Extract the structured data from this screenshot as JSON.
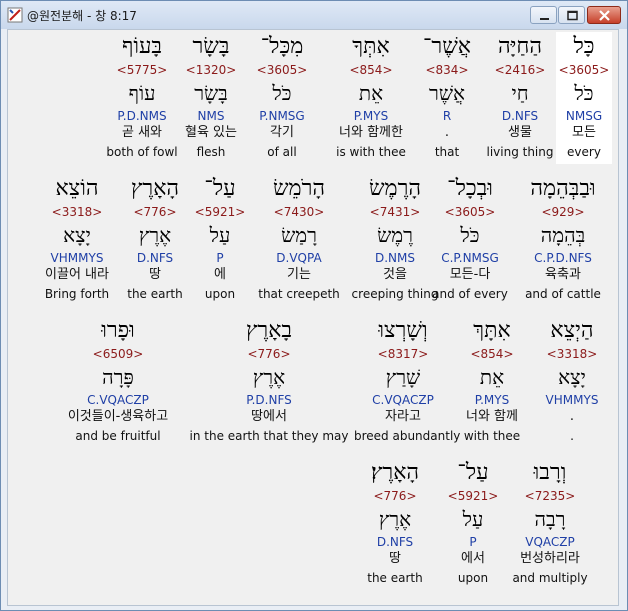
{
  "window": {
    "title": "@원전분해 - 창 8:17"
  },
  "rows": [
    [
      {
        "heb": "כָּל",
        "num": "<3605>",
        "lex": "כֹּל",
        "morph": "NMSG",
        "kor": "모든",
        "eng": "every",
        "highlight": true
      },
      {
        "heb": "הַחַיָּה",
        "num": "<2416>",
        "lex": "חַי",
        "morph": "D.NFS",
        "kor": "생물",
        "eng": "living thing"
      },
      {
        "heb": "אֲשֶׁר־",
        "num": "<834>",
        "lex": "אֲשֶׁר",
        "morph": "R",
        "kor": ".",
        "eng": "that"
      },
      {
        "heb": "אִתְּךָ",
        "num": "<854>",
        "lex": "אֵת",
        "morph": "P.MYS",
        "kor": "너와 함께한",
        "eng": "is with thee"
      },
      {
        "heb": "מִכָּל־",
        "num": "<3605>",
        "lex": "כֹּל",
        "morph": "P.NMSG",
        "kor": "각기",
        "eng": "of all"
      },
      {
        "heb": "בָּשָׂר",
        "num": "<1320>",
        "lex": "בָּשָׂר",
        "morph": "NMS",
        "kor": "혈육 있는",
        "eng": "flesh"
      },
      {
        "heb": "בָּעוֹף",
        "num": "<5775>",
        "lex": "עוֹף",
        "morph": "P.D.NMS",
        "kor": "곧 새와",
        "eng": "both of fowl"
      }
    ],
    [
      {
        "heb": "וּבַבְּהֵמָה",
        "num": "<929>",
        "lex": "בְּהֵמָה",
        "morph": "C.P.D.NFS",
        "kor": "육축과",
        "eng": "and of cattle"
      },
      {
        "heb": "וּבְכָל־",
        "num": "<3605>",
        "lex": "כֹּל",
        "morph": "C.P.NMSG",
        "kor": "모든-다",
        "eng": "and of every"
      },
      {
        "heb": "הָרֶמֶשׂ",
        "num": "<7431>",
        "lex": "רֶמֶשׂ",
        "morph": "D.NMS",
        "kor": "것을",
        "eng": "creeping thing"
      },
      {
        "heb": "הָרֹמֵשׂ",
        "num": "<7430>",
        "lex": "רָמַשׂ",
        "morph": "D.VQPA",
        "kor": "기는",
        "eng": "that creepeth"
      },
      {
        "heb": "עַל־",
        "num": "<5921>",
        "lex": "עַל",
        "morph": "P",
        "kor": "에",
        "eng": "upon"
      },
      {
        "heb": "הָאָרֶץ",
        "num": "<776>",
        "lex": "אֶרֶץ",
        "morph": "D.NFS",
        "kor": "땅",
        "eng": "the earth"
      },
      {
        "heb": "הוֹצֵא",
        "num": "<3318>",
        "lex": "יָצָא",
        "morph": "VHMMYS",
        "kor": "이끌어 내라",
        "eng": "Bring forth"
      }
    ],
    [
      {
        "heb": "הַיְצֵא",
        "num": "<3318>",
        "lex": "יָצָא",
        "morph": "VHMMYS",
        "kor": ".",
        "eng": "."
      },
      {
        "heb": "אִתָּךְ",
        "num": "<854>",
        "lex": "אֵת",
        "morph": "P.MYS",
        "kor": "너와 함께",
        "eng": "with thee"
      },
      {
        "heb": "וְשָׁרְצוּ",
        "num": "<8317>",
        "lex": "שָׁרַץ",
        "morph": "C.VQACZP",
        "kor": "자라고",
        "eng": "breed abundantly"
      },
      {
        "heb": "בָאָרֶץ",
        "num": "<776>",
        "lex": "אֶרֶץ",
        "morph": "P.D.NFS",
        "kor": "땅에서",
        "eng": "in the earth that they may"
      },
      {
        "heb": "וּפָרוּ",
        "num": "<6509>",
        "lex": "פָּרָה",
        "morph": "C.VQACZP",
        "kor": "이것들이-생육하고",
        "eng": "and be fruitful"
      }
    ],
    [
      {
        "heb": "וְרָבוּ",
        "num": "<7235>",
        "lex": "רָבָה",
        "morph": "VQACZP",
        "kor": "번성하리라",
        "eng": "and multiply"
      },
      {
        "heb": "עַל־",
        "num": "<5921>",
        "lex": "עַל",
        "morph": "P",
        "kor": "에서",
        "eng": "upon"
      },
      {
        "heb": "הָאָרֶץ׃",
        "num": "<776>",
        "lex": "אֶרֶץ",
        "morph": "D.NFS",
        "kor": "땅",
        "eng": "the earth"
      }
    ]
  ]
}
